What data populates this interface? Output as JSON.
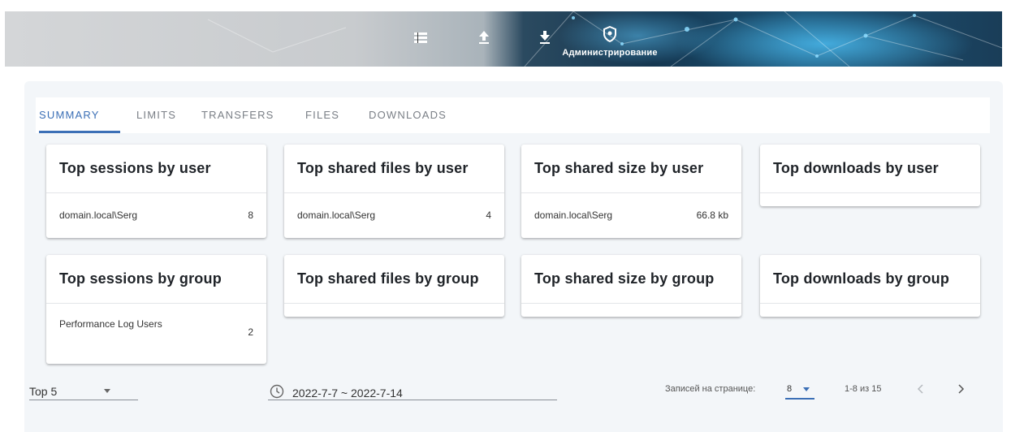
{
  "header": {
    "icons": [
      "list-icon",
      "upload-icon",
      "download-icon",
      "shield-icon"
    ],
    "admin_label": "Администрирование"
  },
  "tabs": [
    {
      "label": "SUMMARY",
      "active": true
    },
    {
      "label": "LIMITS",
      "active": false
    },
    {
      "label": "TRANSFERS",
      "active": false
    },
    {
      "label": "FILES",
      "active": false
    },
    {
      "label": "DOWNLOADS",
      "active": false
    }
  ],
  "cards": {
    "sessions_user": {
      "title": "Top sessions by user",
      "rows": [
        {
          "name": "domain.local\\Serg",
          "value": "8"
        }
      ]
    },
    "shared_files_user": {
      "title": "Top shared files by user",
      "rows": [
        {
          "name": "domain.local\\Serg",
          "value": "4"
        }
      ]
    },
    "shared_size_user": {
      "title": "Top shared size by user",
      "rows": [
        {
          "name": "domain.local\\Serg",
          "value": "66.8 kb"
        }
      ]
    },
    "downloads_user": {
      "title": "Top downloads by user",
      "rows": []
    },
    "sessions_group": {
      "title": "Top sessions by group",
      "rows": [
        {
          "name": "Performance Log Users",
          "value": "2"
        }
      ]
    },
    "shared_files_group": {
      "title": "Top shared files by group",
      "rows": []
    },
    "shared_size_group": {
      "title": "Top shared size by group",
      "rows": []
    },
    "downloads_group": {
      "title": "Top downloads by group",
      "rows": []
    }
  },
  "footer": {
    "top_select": "Top 5",
    "date_range": "2022-7-7 ~ 2022-7-14",
    "rows_per_page_label": "Записей на странице:",
    "rows_per_page": "8",
    "page_range": "1-8 из 15"
  },
  "colors": {
    "accent": "#3b6fb6",
    "panel_bg": "#f3f6f9"
  }
}
